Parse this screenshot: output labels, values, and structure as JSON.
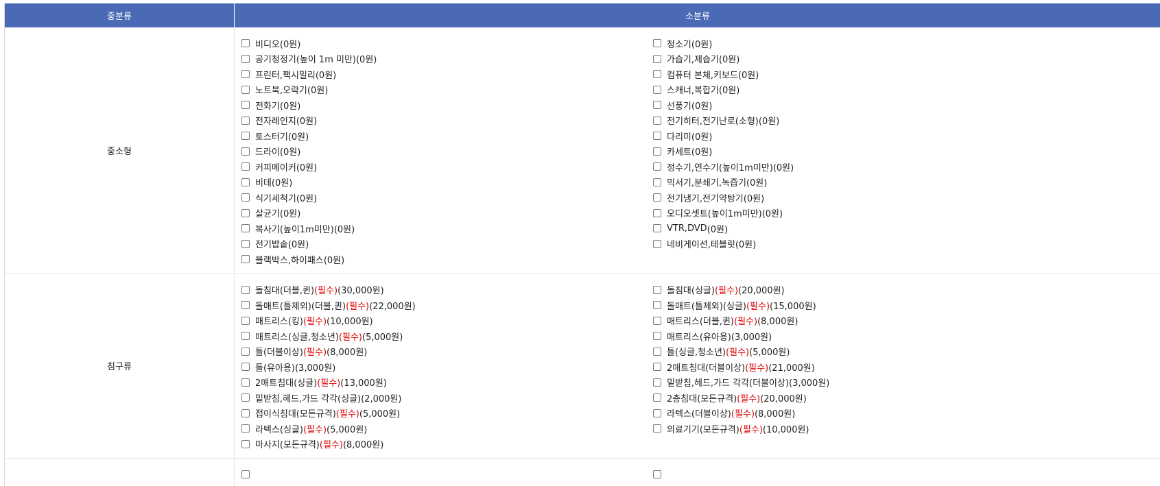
{
  "header": {
    "mid_category": "중분류",
    "sub_category": "소분류"
  },
  "required_label": "필수",
  "groups": [
    {
      "name": "중소형",
      "left": [
        {
          "name": "비디오",
          "req": false,
          "price": "(0원)"
        },
        {
          "name": "공기청정기(높이 1m 미만)",
          "req": false,
          "price": "(0원)"
        },
        {
          "name": "프린터,팩시밀리",
          "req": false,
          "price": "(0원)"
        },
        {
          "name": "노트북,오락기",
          "req": false,
          "price": "(0원)"
        },
        {
          "name": "전화기",
          "req": false,
          "price": "(0원)"
        },
        {
          "name": "전자레인지",
          "req": false,
          "price": "(0원)"
        },
        {
          "name": "토스터기",
          "req": false,
          "price": "(0원)"
        },
        {
          "name": "드라이",
          "req": false,
          "price": "(0원)"
        },
        {
          "name": "커피메이커",
          "req": false,
          "price": "(0원)"
        },
        {
          "name": "비데",
          "req": false,
          "price": "(0원)"
        },
        {
          "name": "식기세척기",
          "req": false,
          "price": "(0원)"
        },
        {
          "name": "살균기",
          "req": false,
          "price": "(0원)"
        },
        {
          "name": "복사기(높이1m미만)",
          "req": false,
          "price": "(0원)"
        },
        {
          "name": "전기밥솥",
          "req": false,
          "price": "(0원)"
        },
        {
          "name": "블랙박스,하이패스",
          "req": false,
          "price": "(0원)"
        }
      ],
      "right": [
        {
          "name": "청소기",
          "req": false,
          "price": "(0원)"
        },
        {
          "name": "가습기,제습기",
          "req": false,
          "price": "(0원)"
        },
        {
          "name": "컴퓨터 본체,키보드",
          "req": false,
          "price": "(0원)"
        },
        {
          "name": "스캐너,복합기",
          "req": false,
          "price": "(0원)"
        },
        {
          "name": "선풍기",
          "req": false,
          "price": "(0원)"
        },
        {
          "name": "전기히터,전기난로(소형)",
          "req": false,
          "price": "(0원)"
        },
        {
          "name": "다리미",
          "req": false,
          "price": "(0원)"
        },
        {
          "name": "카세트",
          "req": false,
          "price": "(0원)"
        },
        {
          "name": "정수기,연수기(높이1m미만)",
          "req": false,
          "price": "(0원)"
        },
        {
          "name": "믹서기,분쇄기,녹즙기",
          "req": false,
          "price": "(0원)"
        },
        {
          "name": "전기냄기,전기약탕기",
          "req": false,
          "price": "(0원)"
        },
        {
          "name": "오디오셋트(높이1m미만)",
          "req": false,
          "price": "(0원)"
        },
        {
          "name": "VTR,DVD",
          "req": false,
          "price": "(0원)"
        },
        {
          "name": "네비게이션,테블릿",
          "req": false,
          "price": "(0원)"
        }
      ]
    },
    {
      "name": "침구류",
      "left": [
        {
          "name": "돌침대(더블,퀸)",
          "req": true,
          "price": "(30,000원)"
        },
        {
          "name": "돌매트(틀제외)(더블,퀸)",
          "req": true,
          "price": "(22,000원)"
        },
        {
          "name": "매트리스(킹)",
          "req": true,
          "price": "(10,000원)"
        },
        {
          "name": "매트리스(싱글,청소년)",
          "req": true,
          "price": "(5,000원)"
        },
        {
          "name": "틀(더블이상)",
          "req": true,
          "price": "(8,000원)"
        },
        {
          "name": "틀(유아용)",
          "req": false,
          "price": "(3,000원)"
        },
        {
          "name": "2매트침대(싱글)",
          "req": true,
          "price": "(13,000원)"
        },
        {
          "name": "밑받침,헤드,가드 각각(싱글)",
          "req": false,
          "price": "(2,000원)"
        },
        {
          "name": "접이식침대(모든규격)",
          "req": true,
          "price": "(5,000원)"
        },
        {
          "name": "라텍스(싱글)",
          "req": true,
          "price": "(5,000원)"
        },
        {
          "name": "마사지(모든규격)",
          "req": true,
          "price": "(8,000원)"
        }
      ],
      "right": [
        {
          "name": "돌침대(싱글)",
          "req": true,
          "price": "(20,000원)"
        },
        {
          "name": "돌매트(틀제외)(싱글)",
          "req": true,
          "price": "(15,000원)"
        },
        {
          "name": "매트리스(더블,퀸)",
          "req": true,
          "price": "(8,000원)"
        },
        {
          "name": "매트리스(유아용)",
          "req": false,
          "price": "(3,000원)"
        },
        {
          "name": "틀(싱글,청소년)",
          "req": true,
          "price": "(5,000원)"
        },
        {
          "name": "2매트침대(더블이상)",
          "req": true,
          "price": "(21,000원)"
        },
        {
          "name": "밑받침,헤드,가드 각각(더블이상)",
          "req": false,
          "price": "(3,000원)"
        },
        {
          "name": "2층침대(모든규격)",
          "req": true,
          "price": "(20,000원)"
        },
        {
          "name": "라텍스(더블이상)",
          "req": true,
          "price": "(8,000원)"
        },
        {
          "name": "의료기기(모든규격)",
          "req": true,
          "price": "(10,000원)"
        }
      ]
    }
  ]
}
